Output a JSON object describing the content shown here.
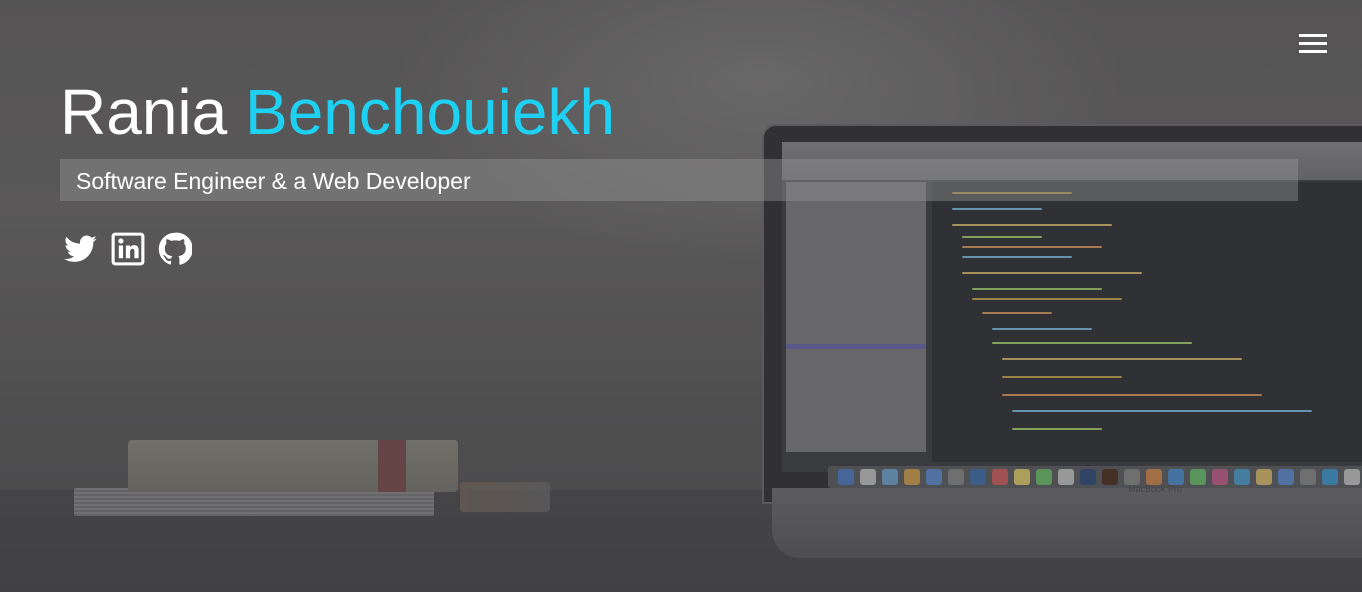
{
  "hero": {
    "first_name": "Rania",
    "last_name": "Benchouiekh",
    "subtitle": "Software Engineer & a Web Developer",
    "accent_color": "#1ed0f2"
  },
  "background": {
    "laptop_brand": "MacBook Pro"
  },
  "socials": [
    {
      "icon": "twitter-icon"
    },
    {
      "icon": "linkedin-icon"
    },
    {
      "icon": "github-icon"
    }
  ],
  "nav": {
    "menu_icon": "hamburger-menu-icon"
  }
}
